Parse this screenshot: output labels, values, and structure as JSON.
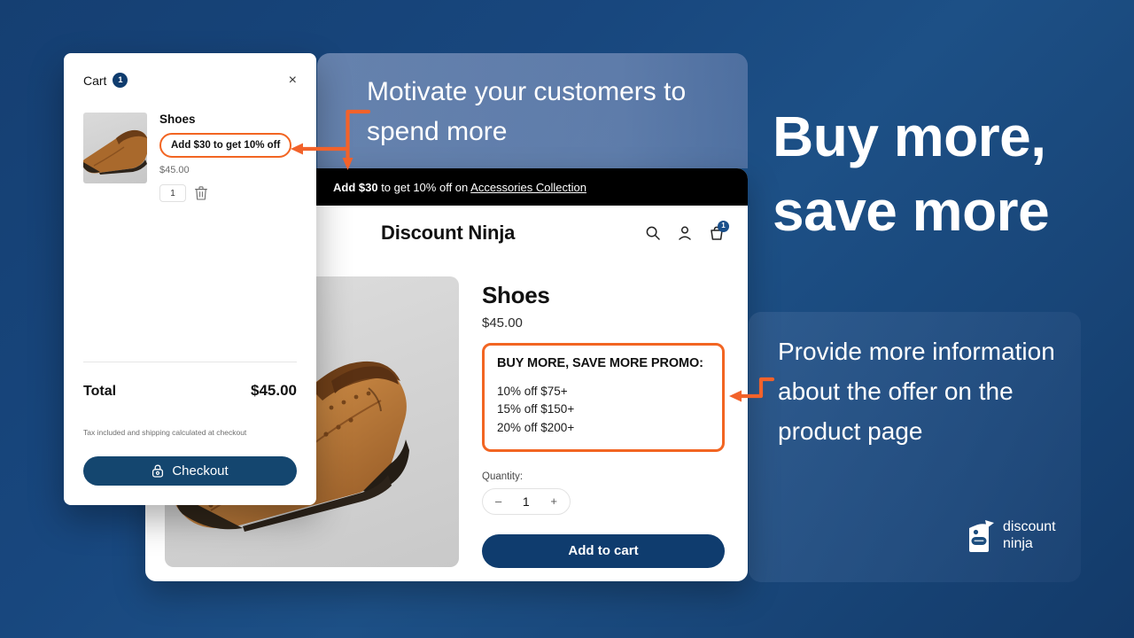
{
  "headline": {
    "line1": "Buy more,",
    "line2": "save more"
  },
  "captions": {
    "top": "Motivate your customers to spend more",
    "right": "Provide more information about the offer on the product page"
  },
  "logo": {
    "line1": "discount",
    "line2": "ninja",
    "icon": "ninja-tag-icon"
  },
  "announcement": {
    "prefix": "Add $30",
    "middle": " to get 10% off on ",
    "link": "Accessories Collection"
  },
  "store": {
    "title": "Discount Ninja",
    "icons": [
      "search-icon",
      "account-icon",
      "cart-icon"
    ],
    "cart_badge": "1"
  },
  "product": {
    "title": "Shoes",
    "price": "$45.00",
    "promo_title": "BUY MORE, SAVE MORE PROMO:",
    "promo_tiers": [
      "10% off $75+",
      "15% off $150+",
      "20% off $200+"
    ],
    "quantity_label": "Quantity:",
    "quantity_decrement": "–",
    "quantity_value": "1",
    "quantity_increment": "+",
    "add_to_cart": "Add to cart"
  },
  "cart": {
    "title": "Cart",
    "count": "1",
    "close": "×",
    "item_name": "Shoes",
    "item_offer": "Add $30 to get 10% off",
    "item_price": "$45.00",
    "item_qty": "1",
    "delete_icon": "trash-icon",
    "total_label": "Total",
    "total_value": "$45.00",
    "note": "Tax included and shipping calculated at checkout",
    "checkout_label": "Checkout",
    "checkout_icon": "lock-icon"
  },
  "colors": {
    "background_navy": "#174479",
    "panel_light": "#6277a8",
    "panel_right": "#2a5a8c",
    "accent_orange": "#f26522",
    "brand_blue": "#0f3c6e",
    "announce_bar": "#000000"
  }
}
